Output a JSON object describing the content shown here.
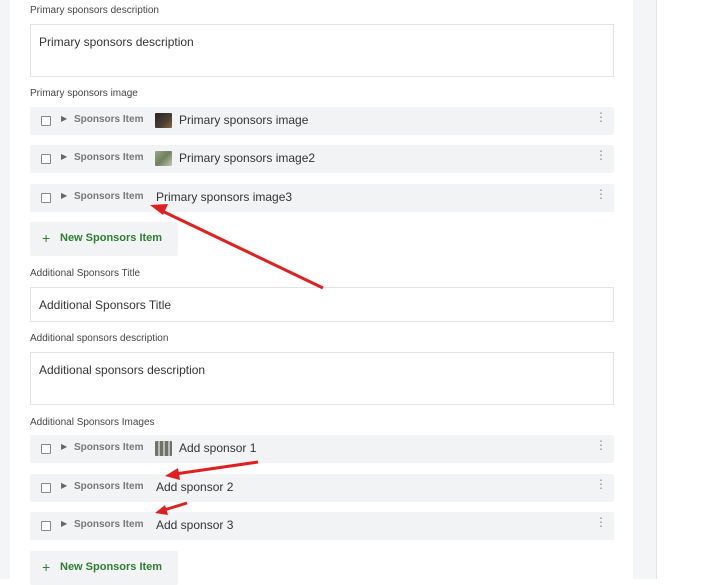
{
  "fields": {
    "primary_description": {
      "label": "Primary sponsors description",
      "value": "Primary sponsors description"
    },
    "primary_image": {
      "label": "Primary sponsors image",
      "items": [
        {
          "type": "Sponsors Item",
          "title": "Primary sponsors image",
          "thumb_color": "#3a3530"
        },
        {
          "type": "Sponsors Item",
          "title": "Primary sponsors image2",
          "thumb_color": "#7d8f6e"
        },
        {
          "type": "Sponsors Item",
          "title": "Primary sponsors image3"
        }
      ],
      "new_button": "New Sponsors Item"
    },
    "additional_title": {
      "label": "Additional Sponsors Title",
      "value": "Additional Sponsors Title"
    },
    "additional_description": {
      "label": "Additional sponsors description",
      "value": "Additional sponsors description"
    },
    "additional_images": {
      "label": "Additional Sponsors Images",
      "items": [
        {
          "type": "Sponsors Item",
          "title": "Add sponsor 1",
          "thumb_color": "#8a8f86"
        },
        {
          "type": "Sponsors Item",
          "title": "Add sponsor 2"
        },
        {
          "type": "Sponsors Item",
          "title": "Add sponsor 3"
        }
      ],
      "new_button": "New Sponsors Item"
    }
  },
  "icons": {
    "checkbox": "checkbox-icon",
    "caret": "caret-right-icon",
    "kebab": "kebab-menu-icon",
    "plus": "plus-icon",
    "arrow": "red-arrow-annotation"
  },
  "colors": {
    "accent": "#2e7d32",
    "annotation": "#e02020",
    "row_bg": "#f2f3f5"
  }
}
